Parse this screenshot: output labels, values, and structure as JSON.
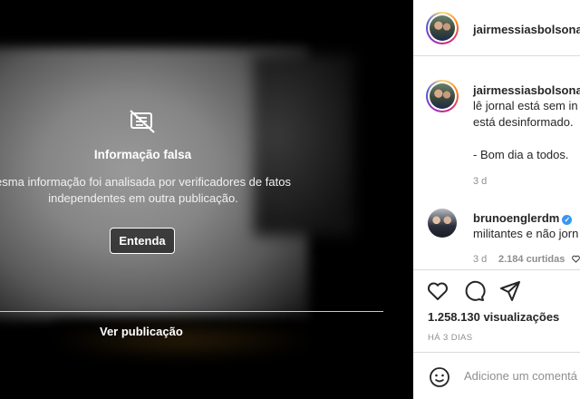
{
  "media": {
    "warning_icon": "eye-slash-icon",
    "warning_title": "Informação falsa",
    "warning_desc_line1": "esma informação foi analisada por verificadores de fatos",
    "warning_desc_line2": "independentes em outra publicação.",
    "understand_label": "Entenda",
    "see_post_label": "Ver publicação"
  },
  "post": {
    "author": "jairmessiasbolsonar",
    "caption_author": "jairmessiasbolsonar",
    "caption_line1": "lê jornal está sem in",
    "caption_line2": "está desinformado.",
    "caption_line3": "- Bom dia a todos.",
    "caption_age": "3 d"
  },
  "comment": {
    "author": "brunoenglerdm",
    "verified": true,
    "text": "militantes e não jorn",
    "age": "3 d",
    "likes": "2.184 curtidas"
  },
  "actions": {
    "icons": [
      "heart-icon",
      "comment-icon",
      "share-icon"
    ]
  },
  "stats": {
    "views": "1.258.130 visualizações",
    "when": "HÁ 3 DIAS"
  },
  "composer": {
    "placeholder": "Adicione um comentá",
    "emoji_icon": "emoji-icon"
  },
  "colors": {
    "accent_verified": "#3897f0",
    "text_primary": "#262626",
    "text_secondary": "#8e8e8e"
  }
}
